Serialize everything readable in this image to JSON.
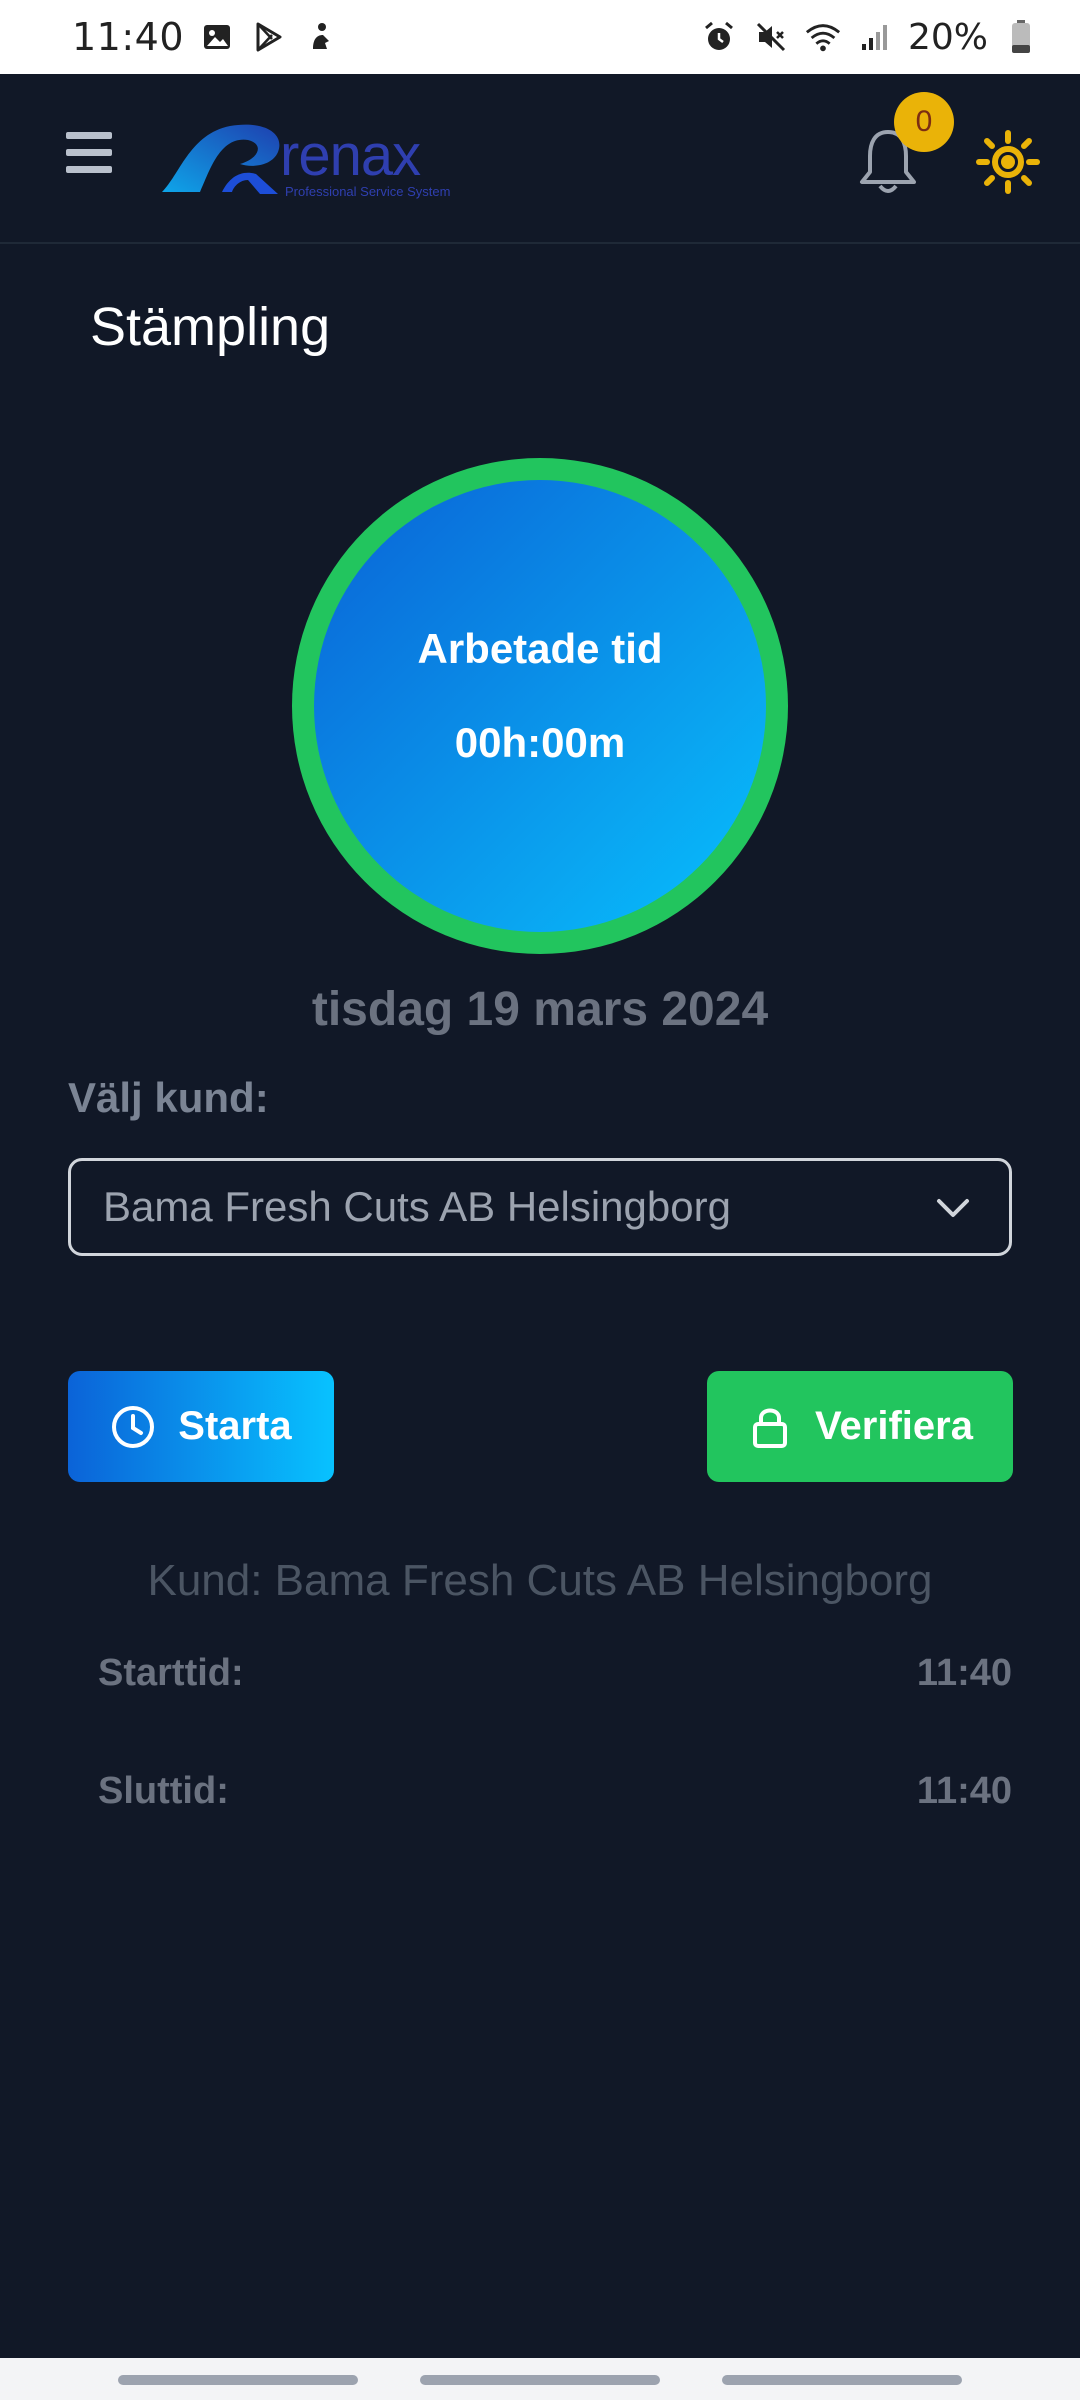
{
  "status_bar": {
    "time": "11:40",
    "battery": "20%",
    "left_icons": [
      "image-icon",
      "play-store-icon",
      "accessibility-icon"
    ],
    "right_icons": [
      "alarm-icon",
      "mute-icon",
      "wifi-icon",
      "signal-icon",
      "battery-icon"
    ]
  },
  "header": {
    "logo_text": "renax",
    "logo_subtitle": "Professional Service System",
    "notification_count": "0",
    "colors": {
      "badge": "#eab308",
      "sun": "#eab308"
    }
  },
  "page": {
    "title": "Stämpling",
    "timer_label": "Arbetade tid",
    "timer_value": "00h:00m",
    "date": "tisdag 19 mars 2024",
    "customer_label": "Välj kund:",
    "customer_selected": "Bama Fresh Cuts AB Helsingborg",
    "start_button": "Starta",
    "verify_button": "Verifiera",
    "summary_customer": "Kund: Bama Fresh Cuts AB Helsingborg",
    "start_time_label": "Starttid:",
    "start_time_value": "11:40",
    "end_time_label": "Sluttid:",
    "end_time_value": "11:40"
  },
  "colors": {
    "background": "#111827",
    "ring": "#22c55e",
    "start_gradient": [
      "#0b63d8",
      "#08c2ff"
    ],
    "verify": "#22c55e"
  }
}
